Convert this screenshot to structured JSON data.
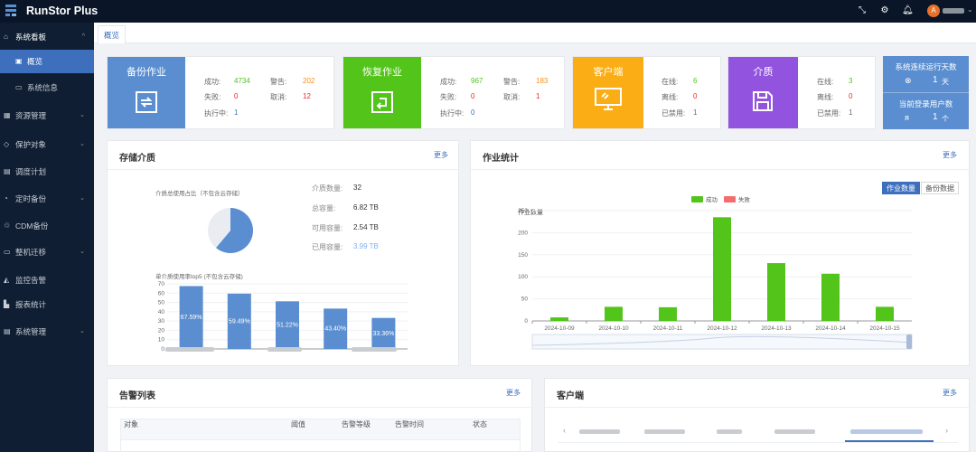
{
  "app": {
    "title": "RunStor Plus",
    "avatar_letter": "A"
  },
  "topbar": {
    "icons": [
      "fullscreen-icon",
      "gear-icon",
      "bell-icon"
    ]
  },
  "sidebar": {
    "items": [
      {
        "label": "系统看板",
        "icon": "home-icon"
      },
      {
        "label": "概览",
        "icon": "dashboard-icon"
      },
      {
        "label": "系统信息",
        "icon": "monitor-icon"
      },
      {
        "label": "资源管理",
        "icon": "grid-icon"
      },
      {
        "label": "保护对象",
        "icon": "shield-icon"
      },
      {
        "label": "调度计划",
        "icon": "calendar-icon"
      },
      {
        "label": "定时备份",
        "icon": "clock-icon"
      },
      {
        "label": "CDM备份",
        "icon": "cdm-icon"
      },
      {
        "label": "整机迁移",
        "icon": "migrate-icon"
      },
      {
        "label": "监控告警",
        "icon": "alert-icon"
      },
      {
        "label": "报表统计",
        "icon": "chart-icon"
      },
      {
        "label": "系统管理",
        "icon": "settings-icon"
      }
    ]
  },
  "tabs": {
    "active": "概览"
  },
  "cards": {
    "backup": {
      "title": "备份作业",
      "color": "#5a8ed0",
      "success_label": "成功:",
      "success": "4734",
      "warning_label": "警告:",
      "warning": "202",
      "fail_label": "失败:",
      "fail": "0",
      "cancel_label": "取消:",
      "cancel": "12",
      "running_label": "执行中:",
      "running": "1"
    },
    "restore": {
      "title": "恢复作业",
      "color": "#52c41a",
      "success_label": "成功:",
      "success": "967",
      "warning_label": "警告:",
      "warning": "183",
      "fail_label": "失败:",
      "fail": "0",
      "cancel_label": "取消:",
      "cancel": "1",
      "running_label": "执行中:",
      "running": "0"
    },
    "client": {
      "title": "客户端",
      "color": "#faad14",
      "online_label": "在线:",
      "online": "6",
      "offline_label": "离线:",
      "offline": "0",
      "disabled_label": "已禁用:",
      "disabled": "1"
    },
    "media": {
      "title": "介质",
      "color": "#9254de",
      "online_label": "在线:",
      "online": "3",
      "offline_label": "离线:",
      "offline": "0",
      "disabled_label": "已禁用:",
      "disabled": "1"
    },
    "system": {
      "color": "#5a8ed0",
      "days_label": "系统连续运行天数",
      "days": "1",
      "days_unit": "天",
      "users_label": "当前登录用户数",
      "users": "1",
      "users_unit": "个"
    }
  },
  "storage": {
    "title": "存储介质",
    "more": "更多",
    "pie_caption": "介质总使用占比（不包含云存储）",
    "count_label": "介质数量:",
    "count": "32",
    "total_label": "总容量:",
    "total": "6.82 TB",
    "avail_label": "可用容量:",
    "avail": "2.54 TB",
    "used_label": "已用容量:",
    "used": "3.99 TB",
    "bar_caption": "单介质使用率top5 (不包含云存储)"
  },
  "jobs": {
    "title": "作业统计",
    "more": "更多",
    "btn_count": "作业数量",
    "btn_data": "备份数据"
  },
  "alarms": {
    "title": "告警列表",
    "more": "更多",
    "columns": [
      "对象",
      "阈值",
      "告警等级",
      "告警时间",
      "状态"
    ]
  },
  "clients": {
    "title": "客户端",
    "more": "更多"
  },
  "chart_data": [
    {
      "type": "pie",
      "title": "介质总使用占比（不包含云存储）",
      "labels": [
        "已用",
        "可用"
      ],
      "values": [
        3.99,
        2.54
      ],
      "colors": [
        "#5a8ed0",
        "#e9ecf0"
      ]
    },
    {
      "type": "bar",
      "title": "单介质使用率top5 (不包含云存储)",
      "values": [
        67.59,
        59.49,
        51.22,
        43.4,
        33.36
      ],
      "value_labels": [
        "67.59%",
        "59.49%",
        "51.22%",
        "43.40%",
        "33.36%"
      ],
      "ylim": [
        0,
        70
      ],
      "yticks": [
        0,
        10,
        20,
        30,
        40,
        50,
        60,
        70
      ],
      "grid": true,
      "color": "#5a8ed0"
    },
    {
      "type": "bar",
      "ylabel": "作业数量",
      "categories": [
        "2024-10-09",
        "2024-10-10",
        "2024-10-11",
        "2024-10-12",
        "2024-10-13",
        "2024-10-14",
        "2024-10-15"
      ],
      "series": [
        {
          "name": "成功",
          "values": [
            8,
            32,
            31,
            235,
            131,
            107,
            32
          ],
          "color": "#52c41a"
        },
        {
          "name": "失败",
          "values": [
            0,
            0,
            0,
            0,
            0,
            0,
            0
          ],
          "color": "#f56c6c"
        }
      ],
      "ylim": [
        0,
        250
      ],
      "yticks": [
        0,
        50,
        100,
        150,
        200,
        250
      ],
      "legend": "top-center",
      "grid": true
    }
  ]
}
